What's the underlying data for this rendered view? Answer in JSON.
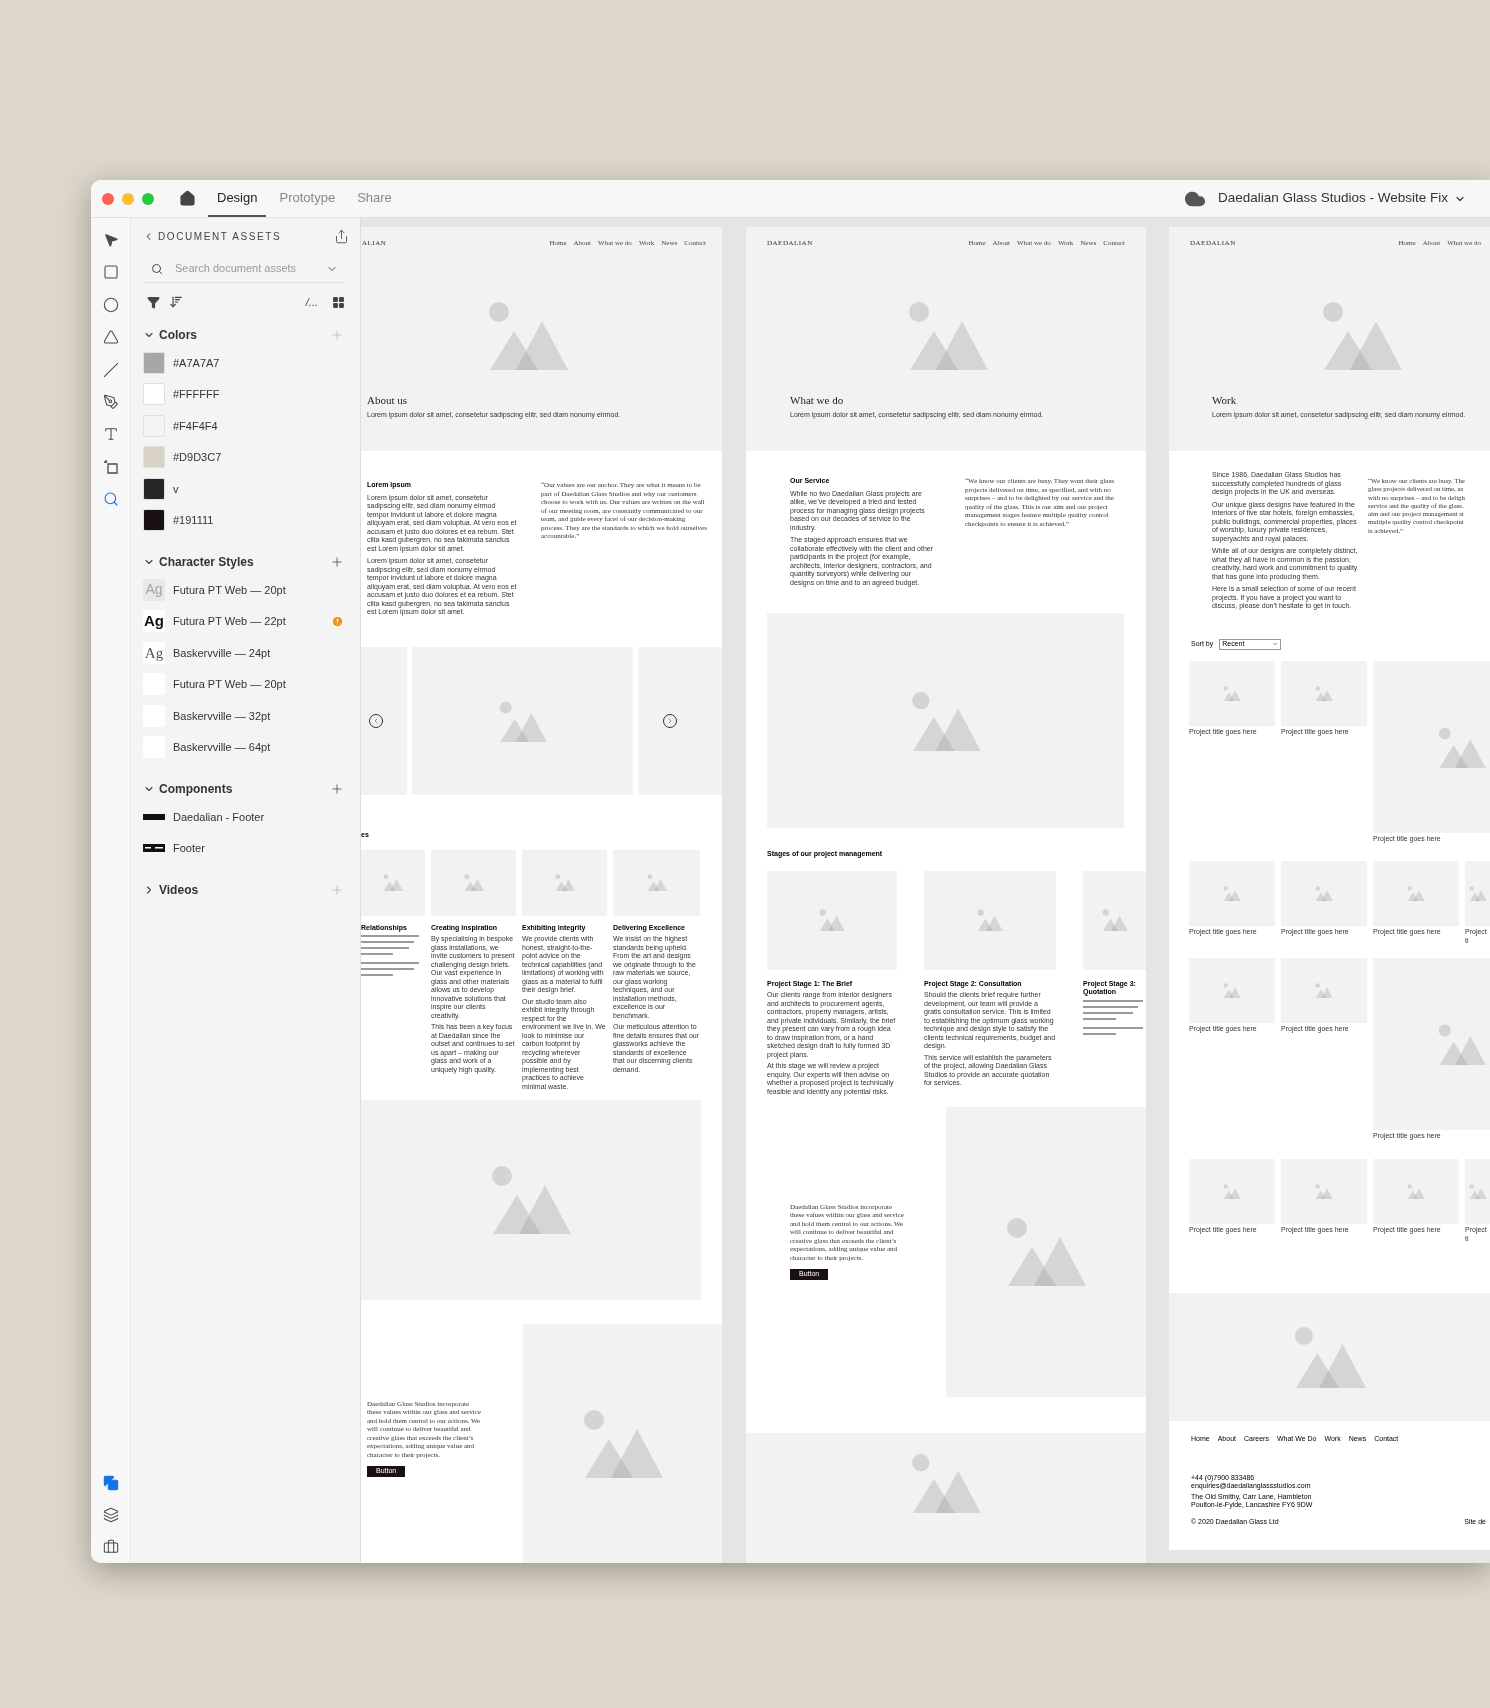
{
  "app": {
    "tabs": [
      {
        "label": "Design",
        "selected": true
      },
      {
        "label": "Prototype",
        "selected": false
      },
      {
        "label": "Share",
        "selected": false
      }
    ],
    "document_title": "Daedalian Glass Studios - Website Fix"
  },
  "tools": [
    {
      "kind": "select",
      "selected": false
    },
    {
      "kind": "rectangle",
      "selected": false
    },
    {
      "kind": "ellipse",
      "selected": false
    },
    {
      "kind": "polygon",
      "selected": false
    },
    {
      "kind": "line",
      "selected": false
    },
    {
      "kind": "pen",
      "selected": false
    },
    {
      "kind": "text",
      "selected": false
    },
    {
      "kind": "artboard",
      "selected": false
    },
    {
      "kind": "zoom",
      "selected": true
    }
  ],
  "panel_tools": [
    {
      "kind": "assets",
      "selected": true
    },
    {
      "kind": "layers",
      "selected": false
    },
    {
      "kind": "plugins",
      "selected": false
    }
  ],
  "assets": {
    "title": "DOCUMENT ASSETS",
    "search": {
      "placeholder": "Search document assets"
    },
    "path_label": "/...",
    "sections": [
      {
        "kind": "colors",
        "title": "Colors",
        "expanded": true,
        "items": [
          {
            "label": "#A7A7A7",
            "color": "#a7a7a7"
          },
          {
            "label": "#FFFFFF",
            "color": "#ffffff"
          },
          {
            "label": "#F4F4F4",
            "color": "#f4f4f4"
          },
          {
            "label": "#D9D3C7",
            "color": "#d9d3c7"
          },
          {
            "label": "v",
            "color": "#262626"
          },
          {
            "label": "#191111",
            "color": "#191111"
          }
        ]
      },
      {
        "kind": "styles",
        "title": "Character Styles",
        "expanded": true,
        "items": [
          {
            "sample": "Ag",
            "kind": "faded",
            "label": "Futura PT Web — 20pt",
            "warning": false
          },
          {
            "sample": "Ag",
            "kind": "bold",
            "label": "Futura PT Web — 22pt",
            "warning": true
          },
          {
            "sample": "Ag",
            "kind": "serif",
            "label": "Baskervville — 24pt",
            "warning": false
          },
          {
            "kind": "blank",
            "label": "Futura PT Web — 20pt",
            "warning": false
          },
          {
            "kind": "blank",
            "label": "Baskervville — 32pt",
            "warning": false
          },
          {
            "kind": "blank",
            "label": "Baskervville — 64pt",
            "warning": false
          }
        ]
      },
      {
        "kind": "components",
        "title": "Components",
        "expanded": true,
        "items": [
          {
            "kind": "bar",
            "label": "Daedalian - Footer"
          },
          {
            "kind": "footer",
            "label": "Footer"
          }
        ]
      },
      {
        "kind": "videos",
        "title": "Videos",
        "expanded": false
      }
    ]
  },
  "about_page": {
    "logo": "ALIAN",
    "nav": [
      "Home",
      "About",
      "What we do",
      "Work",
      "News",
      "Contact"
    ],
    "heading": "About us",
    "subtitle": "Lorem ipsum dolor sit amet, consetetur sadipscing elitr, sed diam nonumy eirmod.",
    "intro_heading": "Lorem ipsum",
    "intro_paragraphs": [
      "Lorem ipsum dolor sit amet, consetetur sadipscing elitr, sed diam nonumy eirmod tempor invidunt ut labore et dolore magna aliquyam erat, sed diam voluptua. At vero eos et accusam et justo duo dolores et ea rebum. Stet clita kasd gubergren, no sea takimata sanctus est Lorem ipsum dolor sit amet.",
      "Lorem ipsum dolor sit amet, consetetur sadipscing elitr, sed diam nonumy eirmod tempor invidunt ut labore et dolore magna aliquyam erat, sed diam voluptua. At vero eos et accusam et justo duo dolores et ea rebum. Stet clita kasd gubergren, no sea takimata sanctus est Lorem ipsum dolor sit amet."
    ],
    "quote": "“Our values are our anchor. They are what it means to be part of Daedalian Glass Studios and why our customers choose to work with us. Our values are written on the wall of our meeting room, are constantly communicated to our team, and guide every facet of our decision-making process. They are the standards to which we hold ourselves accountable.”",
    "values_label": "es",
    "values": [
      {
        "title": "Relationships"
      },
      {
        "title": "Creating inspiration",
        "paragraphs": [
          "By specialising in bespoke glass installations, we invite customers to present challenging design briefs. Our vast experience in glass and other materials allows us to develop innovative solutions that inspire our clients creativity.",
          "This has been a key focus at Daedalian since the outset and continues to set us apart – making our glass and work of a uniquely high quality."
        ]
      },
      {
        "title": "Exhibiting integrity",
        "paragraphs": [
          "We provide clients with honest, straight-to-the-point advice on the technical capabilities (and limitations) of working with glass as a material to fulfil their design brief.",
          "Our studio team also exhibit integrity through respect for the environment we live in. We look to minimise our carbon footprint by recycling wherever possible and by implementing best practices to achieve minimal waste."
        ]
      },
      {
        "title": "Delivering Excellence",
        "paragraphs": [
          "We insist on the highest standards being upheld. From the art and designs we originate through to the raw materials we source, our glass working techniques, and our installation methods, excellence is our benchmark.",
          "Our meticulous attention to fine details ensures that our glassworks achieve the standards of excellence that our discerning clients demand."
        ]
      }
    ],
    "closing": "Daedalian Glass Studios incorporate these values within our glass and service and hold them central to our actions. We will continue to deliver beautiful and creative glass that exceeds the client’s expectations, adding unique value and character to their projects.",
    "button": "Button"
  },
  "services_page": {
    "logo": "DAEDALIAN",
    "nav": [
      "Home",
      "About",
      "What we do",
      "Work",
      "News",
      "Contact"
    ],
    "heading": "What we do",
    "subtitle": "Lorem ipsum dolor sit amet, consetetur sadipscing elitr, sed diam nonumy eirmod.",
    "intro_heading": "Our Service",
    "intro_paragraphs": [
      "While no two Daedalian Glass projects are alike, we’ve developed a tried and tested process for managing glass design projects based on our decades of service to the industry.",
      "The staged approach ensures that we collaborate effectively with the client and other participants in the project (for example, architects, interior designers, contractors, and quantity surveyors) while delivering our designs on time and to an agreed budget."
    ],
    "quote": "“We know our clients are busy. They want their glass projects delivered on time, as specified, and with no surprises – and to be delighted by our service and the quality of the glass. This is our aim and our project management stages feature multiple quality control checkpoints to ensure it is achieved.”",
    "stages_label": "Stages of our project management",
    "stages": [
      {
        "title": "Project Stage 1: The Brief",
        "paragraphs": [
          "Our clients range from interior designers and architects to procurement agents, contractors, property managers, artists, and private individuals. Similarly, the brief they present can vary from a rough idea to draw inspiration from, or a hand sketched design draft to fully formed 3D project plans.",
          "At this stage we will review a project enquiry. Our experts will then advise on whether a proposed project is technically feasible and identify any potential risks."
        ]
      },
      {
        "title": "Project Stage 2: Consultation",
        "paragraphs": [
          "Should the clients brief require further development, our team will provide a gratis consultation service. This is limited to establishing the optimum glass working technique and design style to satisfy the clients technical requirements, budget and design.",
          "This service will establish the parameters of the project, allowing Daedalian Glass Studios to provide an accurate quotation for services."
        ]
      },
      {
        "title": "Project Stage 3: Quotation"
      }
    ],
    "closing": "Daedalian Glass Studios incorporate these values within our glass and service and hold them central to our actions. We will continue to deliver beautiful and creative glass that exceeds the client’s expectations, adding unique value and character to their projects.",
    "button": "Button"
  },
  "work_page": {
    "logo": "DAEDALIAN",
    "nav": [
      "Home",
      "About",
      "What we do"
    ],
    "heading": "Work",
    "subtitle": "Lorem ipsum dolor sit amet, consetetur sadipscing elitr, sed diam nonumy eirmod.",
    "intro_paragraphs": [
      "Since 1986, Daedalian Glass Studios has successfully completed hundreds of glass design projects in the UK and overseas.",
      "Our unique glass designs have featured in the interiors of five star hotels, foreign embassies, public buildings, commercial properties, places of worship, luxury private residences, superyachts and royal palaces.",
      "While all of our designs are completely distinct, what they all have in common is the passion, creativity, hard work and commitment to quality that has gone into producing them.",
      "Here is a small selection of some of our recent projects. If you have a project you want to discuss, please don’t hesitate to get in touch."
    ],
    "quote_lines": [
      "“We know our clients are busy. The",
      "glass projects delivered on time, as",
      "with no surprises – and to be deligh",
      "service and the quality of the glass.",
      "aim and our project management st",
      "multiple quality control checkpoint",
      "is achieved.”"
    ],
    "sort_label": "Sort by",
    "sort_value": "Recent",
    "project_rows": [
      [
        {
          "kind": "small",
          "caption": "Project title goes here"
        },
        {
          "kind": "small",
          "caption": "Project title goes here"
        },
        {
          "kind": "large",
          "caption": "Project title goes here"
        }
      ],
      [
        {
          "kind": "small",
          "caption": "Project title goes here"
        },
        {
          "kind": "small",
          "caption": "Project title goes here"
        },
        {
          "kind": "small",
          "caption": "Project title goes here"
        },
        {
          "kind": "cut",
          "caption": "Project ti"
        }
      ],
      [
        {
          "kind": "small",
          "caption": "Project title goes here"
        },
        {
          "kind": "small",
          "caption": "Project title goes here"
        },
        {
          "kind": "large",
          "caption": "Project title goes here"
        }
      ],
      [
        {
          "kind": "small",
          "caption": "Project title goes here"
        },
        {
          "kind": "small",
          "caption": "Project title goes here"
        },
        {
          "kind": "small",
          "caption": "Project title goes here"
        },
        {
          "kind": "cut",
          "caption": "Project ti"
        }
      ]
    ],
    "footer_nav": [
      "Home",
      "About",
      "Careers",
      "What We Do",
      "Work",
      "News",
      "Contact"
    ],
    "contact": [
      "+44 (0)7900 833486",
      "enquiries@daedalianglassstudios.com"
    ],
    "address": [
      "The Old Smithy, Carr Lane, Hambleton",
      "Poulton-le-Fylde, Lancashire FY6 9DW"
    ],
    "copyright": "© 2020 Daedalian Glass Ltd",
    "footer_link": "Site de"
  }
}
